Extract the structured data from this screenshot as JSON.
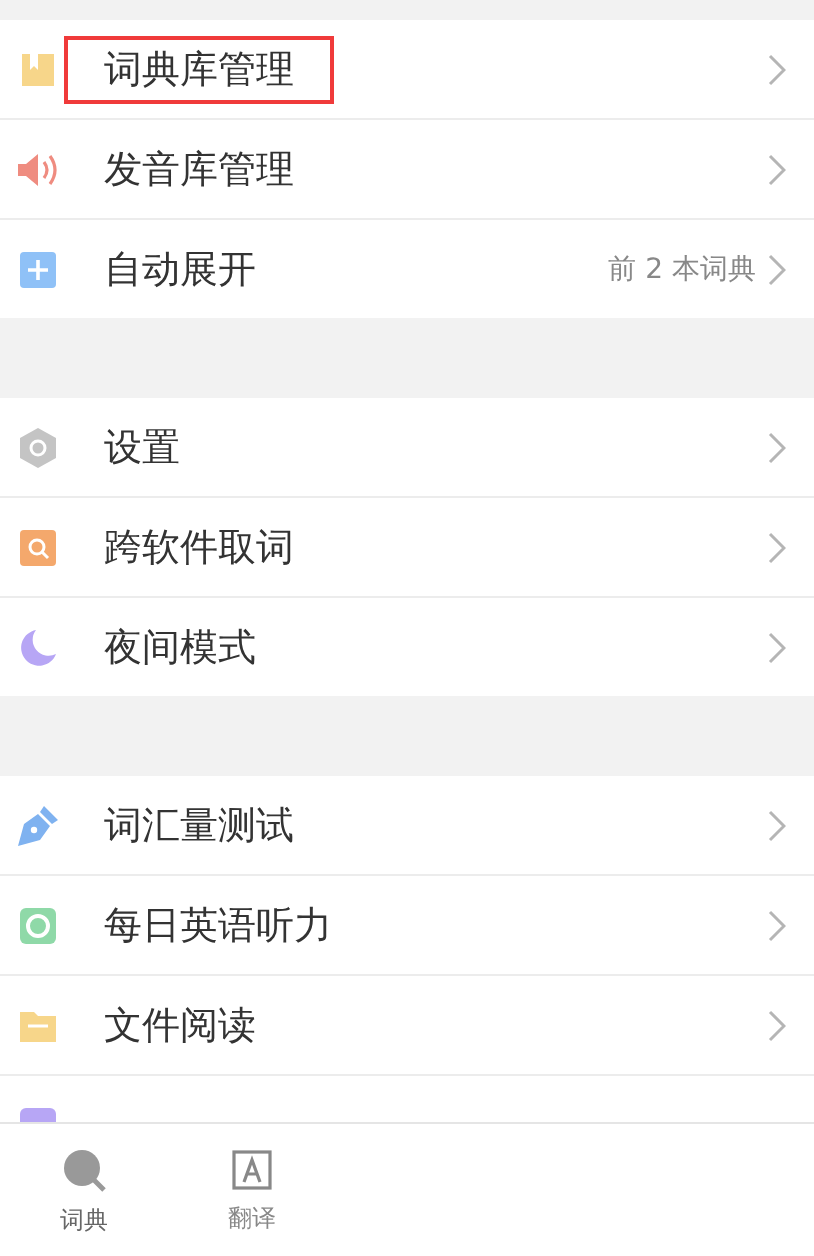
{
  "sections": [
    {
      "items": [
        {
          "label": "词典库管理",
          "highlighted": true
        },
        {
          "label": "发音库管理",
          "highlighted": false
        },
        {
          "label": "自动展开",
          "value": "前 2 本词典",
          "highlighted": false
        }
      ]
    },
    {
      "items": [
        {
          "label": "设置",
          "highlighted": false
        },
        {
          "label": "跨软件取词",
          "highlighted": false
        },
        {
          "label": "夜间模式",
          "highlighted": false
        }
      ]
    },
    {
      "items": [
        {
          "label": "词汇量测试",
          "highlighted": false
        },
        {
          "label": "每日英语听力",
          "highlighted": false
        },
        {
          "label": "文件阅读",
          "highlighted": false
        }
      ]
    }
  ],
  "tab_bar": [
    {
      "label": "词典",
      "selected": true
    },
    {
      "label": "翻译",
      "selected": false
    }
  ]
}
